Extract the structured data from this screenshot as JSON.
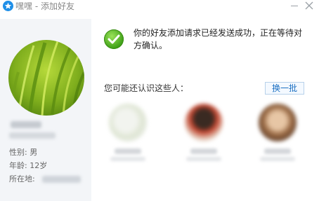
{
  "window": {
    "title": "嘿嘿 - 添加好友",
    "accent_color": "#1f8fe8"
  },
  "profile": {
    "gender_label": "性别: 男",
    "age_label": "年龄: 12岁",
    "location_label": "所在地:"
  },
  "result": {
    "status_icon": "check-circle-icon",
    "status_color": "#4caf1b",
    "message": "你的好友添加请求已经发送成功，正在等待对方确认。"
  },
  "suggestions": {
    "label": "您可能还认识这些人：",
    "refresh_label": "换一批"
  }
}
